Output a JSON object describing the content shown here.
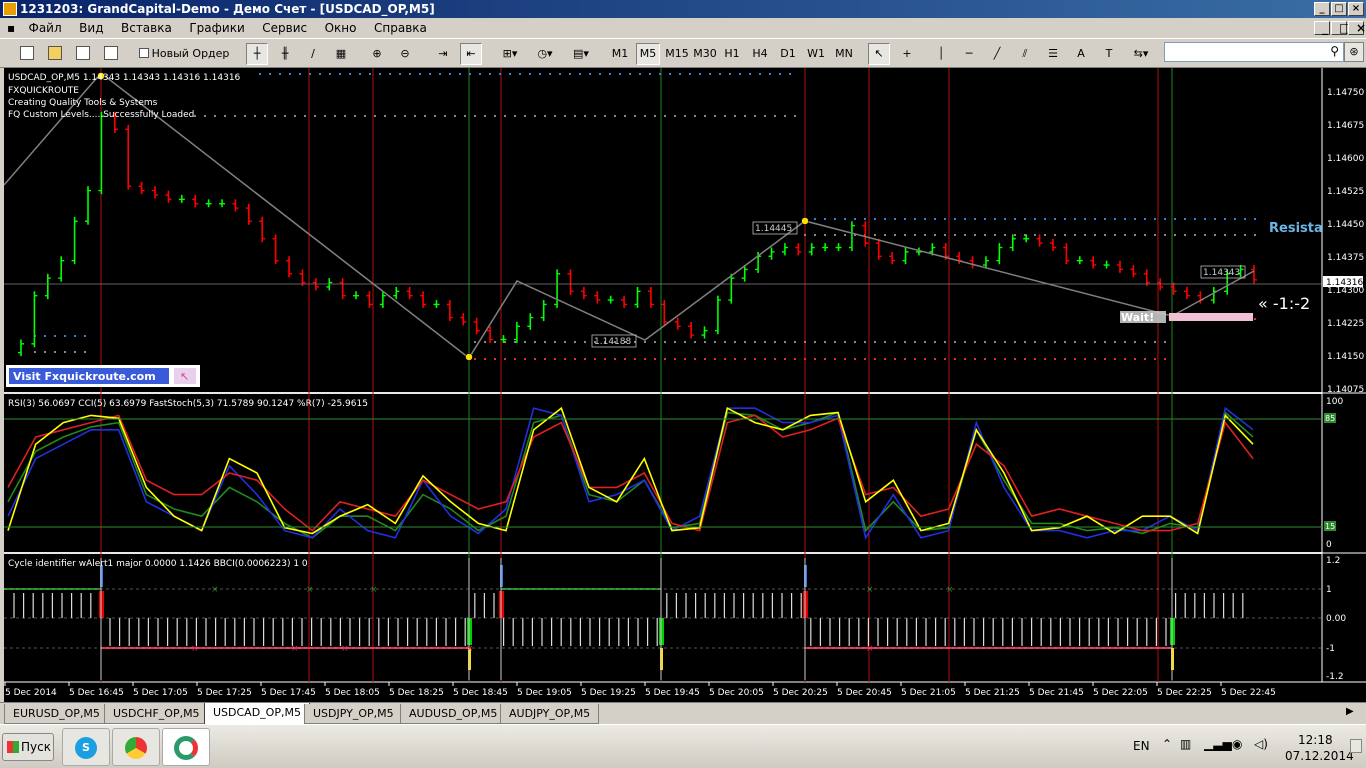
{
  "window": {
    "title": "1231203: GrandCapital-Demo - Демо Счет - [USDCAD_OP,M5]"
  },
  "menu": [
    "Файл",
    "Вид",
    "Вставка",
    "Графики",
    "Сервис",
    "Окно",
    "Справка"
  ],
  "toolbar": {
    "new_order": "Новый Ордер",
    "timeframes": [
      "M1",
      "M5",
      "M15",
      "M30",
      "H1",
      "H4",
      "D1",
      "W1",
      "MN"
    ],
    "active_tf": "M5"
  },
  "chart": {
    "header": "USDCAD_OP,M5  1.14343 1.14343 1.14316 1.14316",
    "fx_lines": [
      "FXQUICKROUTE",
      "Creating Quality Tools & Systems",
      "FQ Custom Levels.....Successfully Loaded"
    ],
    "visit_label": "Visit Fxquickroute.com",
    "price_axis": [
      "1.14750",
      "1.14675",
      "1.14600",
      "1.14525",
      "1.14450",
      "1.14375",
      "1.14300",
      "1.14225",
      "1.14150",
      "1.14075"
    ],
    "current_price": "1.14316",
    "zigzag_labels": [
      "1.14445",
      "1.14188",
      "1.14343"
    ],
    "wait_label": "Wait!",
    "arrow_label": "« -1:-2",
    "resist_label": "Resista",
    "colors": {
      "bull": "#00ff00",
      "bear": "#ff0000",
      "bg": "#000000",
      "zigzag": "#808080"
    }
  },
  "osc": {
    "header": "RSI(3) 56.0697  CCI(5) 63.6979  FastStoch(5,3) 71.5789 90.1247  %R(7) -25.9615",
    "levels": [
      "100",
      "85",
      "15",
      "0"
    ]
  },
  "cycle": {
    "header": "Cycle identifier wAlert1 major 0.0000 1.1426  BBCI(0.0006223) 1 0",
    "levels": [
      "1.2",
      "1",
      "0.00",
      "-1",
      "-1.2"
    ]
  },
  "time_axis": [
    "5 Dec 2014",
    "5 Dec 16:45",
    "5 Dec 17:05",
    "5 Dec 17:25",
    "5 Dec 17:45",
    "5 Dec 18:05",
    "5 Dec 18:25",
    "5 Dec 18:45",
    "5 Dec 19:05",
    "5 Dec 19:25",
    "5 Dec 19:45",
    "5 Dec 20:05",
    "5 Dec 20:25",
    "5 Dec 20:45",
    "5 Dec 21:05",
    "5 Dec 21:25",
    "5 Dec 21:45",
    "5 Dec 22:05",
    "5 Dec 22:25",
    "5 Dec 22:45"
  ],
  "tabs": [
    "EURUSD_OP,M5",
    "USDCHF_OP,M5",
    "USDCAD_OP,M5",
    "USDJPY_OP,M5",
    "AUDUSD_OP,M5",
    "AUDJPY_OP,M5"
  ],
  "active_tab": "USDCAD_OP,M5",
  "taskbar": {
    "start": "Пуск",
    "lang": "EN",
    "time": "12:18",
    "date": "07.12.2014"
  }
}
